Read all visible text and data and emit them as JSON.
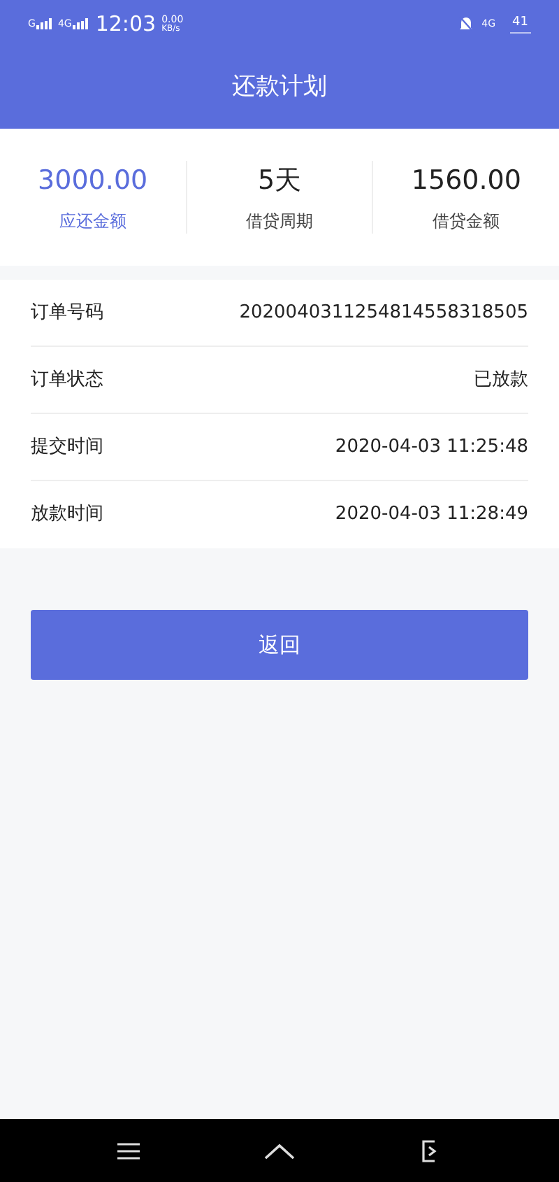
{
  "status_bar": {
    "time": "12:03",
    "speed": "0.00",
    "speed_unit": "KB/s",
    "signal_1": "G",
    "signal_2": "4G",
    "network": "4G",
    "battery": "41"
  },
  "title": "还款计划",
  "summary": [
    {
      "value": "3000.00",
      "label": "应还金额",
      "kind": "accent"
    },
    {
      "value": "5天",
      "label": "借贷周期",
      "kind": "plain"
    },
    {
      "value": "1560.00",
      "label": "借贷金额",
      "kind": "plain"
    }
  ],
  "details": [
    {
      "label": "订单号码",
      "value": "2020040311254814558318505"
    },
    {
      "label": "订单状态",
      "value": "已放款"
    },
    {
      "label": "提交时间",
      "value": "2020-04-03 11:25:48"
    },
    {
      "label": "放款时间",
      "value": "2020-04-03 11:28:49"
    }
  ],
  "back_button": "返回"
}
